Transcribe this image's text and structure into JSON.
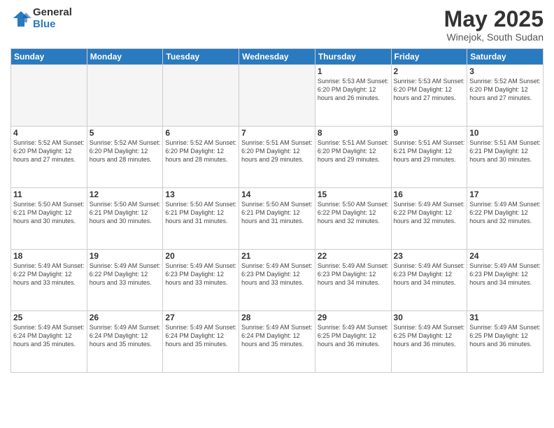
{
  "logo": {
    "general": "General",
    "blue": "Blue"
  },
  "title": "May 2025",
  "location": "Winejok, South Sudan",
  "days_of_week": [
    "Sunday",
    "Monday",
    "Tuesday",
    "Wednesday",
    "Thursday",
    "Friday",
    "Saturday"
  ],
  "weeks": [
    [
      {
        "day": "",
        "info": ""
      },
      {
        "day": "",
        "info": ""
      },
      {
        "day": "",
        "info": ""
      },
      {
        "day": "",
        "info": ""
      },
      {
        "day": "1",
        "info": "Sunrise: 5:53 AM\nSunset: 6:20 PM\nDaylight: 12 hours\nand 26 minutes."
      },
      {
        "day": "2",
        "info": "Sunrise: 5:53 AM\nSunset: 6:20 PM\nDaylight: 12 hours\nand 27 minutes."
      },
      {
        "day": "3",
        "info": "Sunrise: 5:52 AM\nSunset: 6:20 PM\nDaylight: 12 hours\nand 27 minutes."
      }
    ],
    [
      {
        "day": "4",
        "info": "Sunrise: 5:52 AM\nSunset: 6:20 PM\nDaylight: 12 hours\nand 27 minutes."
      },
      {
        "day": "5",
        "info": "Sunrise: 5:52 AM\nSunset: 6:20 PM\nDaylight: 12 hours\nand 28 minutes."
      },
      {
        "day": "6",
        "info": "Sunrise: 5:52 AM\nSunset: 6:20 PM\nDaylight: 12 hours\nand 28 minutes."
      },
      {
        "day": "7",
        "info": "Sunrise: 5:51 AM\nSunset: 6:20 PM\nDaylight: 12 hours\nand 29 minutes."
      },
      {
        "day": "8",
        "info": "Sunrise: 5:51 AM\nSunset: 6:20 PM\nDaylight: 12 hours\nand 29 minutes."
      },
      {
        "day": "9",
        "info": "Sunrise: 5:51 AM\nSunset: 6:21 PM\nDaylight: 12 hours\nand 29 minutes."
      },
      {
        "day": "10",
        "info": "Sunrise: 5:51 AM\nSunset: 6:21 PM\nDaylight: 12 hours\nand 30 minutes."
      }
    ],
    [
      {
        "day": "11",
        "info": "Sunrise: 5:50 AM\nSunset: 6:21 PM\nDaylight: 12 hours\nand 30 minutes."
      },
      {
        "day": "12",
        "info": "Sunrise: 5:50 AM\nSunset: 6:21 PM\nDaylight: 12 hours\nand 30 minutes."
      },
      {
        "day": "13",
        "info": "Sunrise: 5:50 AM\nSunset: 6:21 PM\nDaylight: 12 hours\nand 31 minutes."
      },
      {
        "day": "14",
        "info": "Sunrise: 5:50 AM\nSunset: 6:21 PM\nDaylight: 12 hours\nand 31 minutes."
      },
      {
        "day": "15",
        "info": "Sunrise: 5:50 AM\nSunset: 6:22 PM\nDaylight: 12 hours\nand 32 minutes."
      },
      {
        "day": "16",
        "info": "Sunrise: 5:49 AM\nSunset: 6:22 PM\nDaylight: 12 hours\nand 32 minutes."
      },
      {
        "day": "17",
        "info": "Sunrise: 5:49 AM\nSunset: 6:22 PM\nDaylight: 12 hours\nand 32 minutes."
      }
    ],
    [
      {
        "day": "18",
        "info": "Sunrise: 5:49 AM\nSunset: 6:22 PM\nDaylight: 12 hours\nand 33 minutes."
      },
      {
        "day": "19",
        "info": "Sunrise: 5:49 AM\nSunset: 6:22 PM\nDaylight: 12 hours\nand 33 minutes."
      },
      {
        "day": "20",
        "info": "Sunrise: 5:49 AM\nSunset: 6:23 PM\nDaylight: 12 hours\nand 33 minutes."
      },
      {
        "day": "21",
        "info": "Sunrise: 5:49 AM\nSunset: 6:23 PM\nDaylight: 12 hours\nand 33 minutes."
      },
      {
        "day": "22",
        "info": "Sunrise: 5:49 AM\nSunset: 6:23 PM\nDaylight: 12 hours\nand 34 minutes."
      },
      {
        "day": "23",
        "info": "Sunrise: 5:49 AM\nSunset: 6:23 PM\nDaylight: 12 hours\nand 34 minutes."
      },
      {
        "day": "24",
        "info": "Sunrise: 5:49 AM\nSunset: 6:23 PM\nDaylight: 12 hours\nand 34 minutes."
      }
    ],
    [
      {
        "day": "25",
        "info": "Sunrise: 5:49 AM\nSunset: 6:24 PM\nDaylight: 12 hours\nand 35 minutes."
      },
      {
        "day": "26",
        "info": "Sunrise: 5:49 AM\nSunset: 6:24 PM\nDaylight: 12 hours\nand 35 minutes."
      },
      {
        "day": "27",
        "info": "Sunrise: 5:49 AM\nSunset: 6:24 PM\nDaylight: 12 hours\nand 35 minutes."
      },
      {
        "day": "28",
        "info": "Sunrise: 5:49 AM\nSunset: 6:24 PM\nDaylight: 12 hours\nand 35 minutes."
      },
      {
        "day": "29",
        "info": "Sunrise: 5:49 AM\nSunset: 6:25 PM\nDaylight: 12 hours\nand 36 minutes."
      },
      {
        "day": "30",
        "info": "Sunrise: 5:49 AM\nSunset: 6:25 PM\nDaylight: 12 hours\nand 36 minutes."
      },
      {
        "day": "31",
        "info": "Sunrise: 5:49 AM\nSunset: 6:25 PM\nDaylight: 12 hours\nand 36 minutes."
      }
    ]
  ]
}
